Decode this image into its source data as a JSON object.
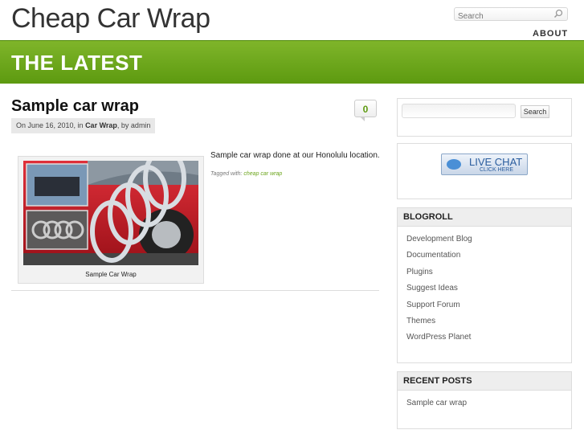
{
  "site": {
    "title": "Cheap Car Wrap"
  },
  "header": {
    "search_placeholder": "Search",
    "nav": {
      "about": "ABOUT"
    }
  },
  "banner": {
    "title": "THE LATEST"
  },
  "post": {
    "title": "Sample car wrap",
    "meta_prefix": "On June 16, 2010, in ",
    "category": "Car Wrap",
    "meta_by": ", by admin",
    "comment_count": "0",
    "image_caption": "Sample Car Wrap",
    "excerpt": "Sample car wrap done at our Honolulu location.",
    "tags_label": "Tagged with: ",
    "tag": "cheap car wrap"
  },
  "sidebar": {
    "search_button": "Search",
    "live_chat": {
      "line1": "LIVE CHAT",
      "line2": "CLICK HERE"
    },
    "blogroll": {
      "heading": "BLOGROLL",
      "items": [
        "Development Blog",
        "Documentation",
        "Plugins",
        "Suggest Ideas",
        "Support Forum",
        "Themes",
        "WordPress Planet"
      ]
    },
    "recent_posts": {
      "heading": "RECENT POSTS",
      "items": [
        "Sample car wrap"
      ]
    }
  },
  "colors": {
    "accent": "#6aa41a",
    "banner_top": "#7fb52a",
    "banner_bottom": "#5d9a10"
  }
}
